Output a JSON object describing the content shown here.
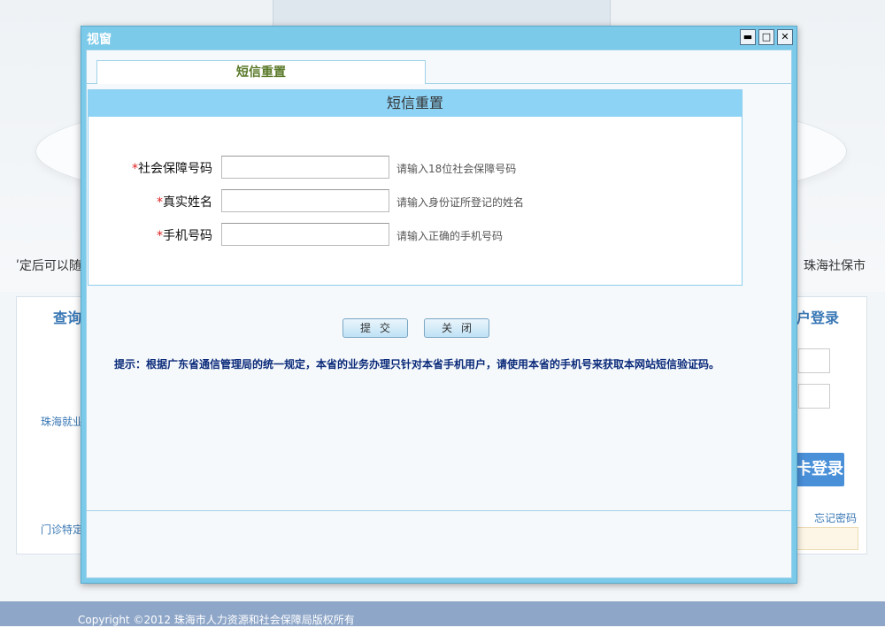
{
  "background": {
    "left_text": "ʹ定后可以随",
    "right_text": "珠海社保市",
    "left_panel_title": "查询",
    "left_item_1": "珠海就业",
    "left_item_2": "门诊特定",
    "right_panel_title": "户登录",
    "right_login_button": "卡登录",
    "right_forgot_link": "忘记密码",
    "footer": "Copyright ©2012  珠海市人力资源和社会保障局版权所有"
  },
  "window": {
    "title": "视窗",
    "controls": {
      "minimize": "▬",
      "maximize": "□",
      "close": "✕"
    }
  },
  "tab": {
    "label": "短信重置"
  },
  "form": {
    "heading": "短信重置",
    "required_mark": "*",
    "fields": [
      {
        "label": "社会保障号码",
        "value": "",
        "hint": "请输入18位社会保障号码"
      },
      {
        "label": "真实姓名",
        "value": "",
        "hint": "请输入身份证所登记的姓名"
      },
      {
        "label": "手机号码",
        "value": "",
        "hint": "请输入正确的手机号码"
      }
    ],
    "submit_label": "提交",
    "close_label": "关闭"
  },
  "tip": "提示：根据广东省通信管理局的统一规定，本省的业务办理只针对本省手机用户，请使用本省的手机号来获取本网站短信验证码。",
  "colors": {
    "window_frame": "#7ccaea",
    "form_header": "#8dd3f6",
    "tab_text": "#5a7a2a",
    "tip_text": "#0a2a7a",
    "required": "#e02020"
  }
}
